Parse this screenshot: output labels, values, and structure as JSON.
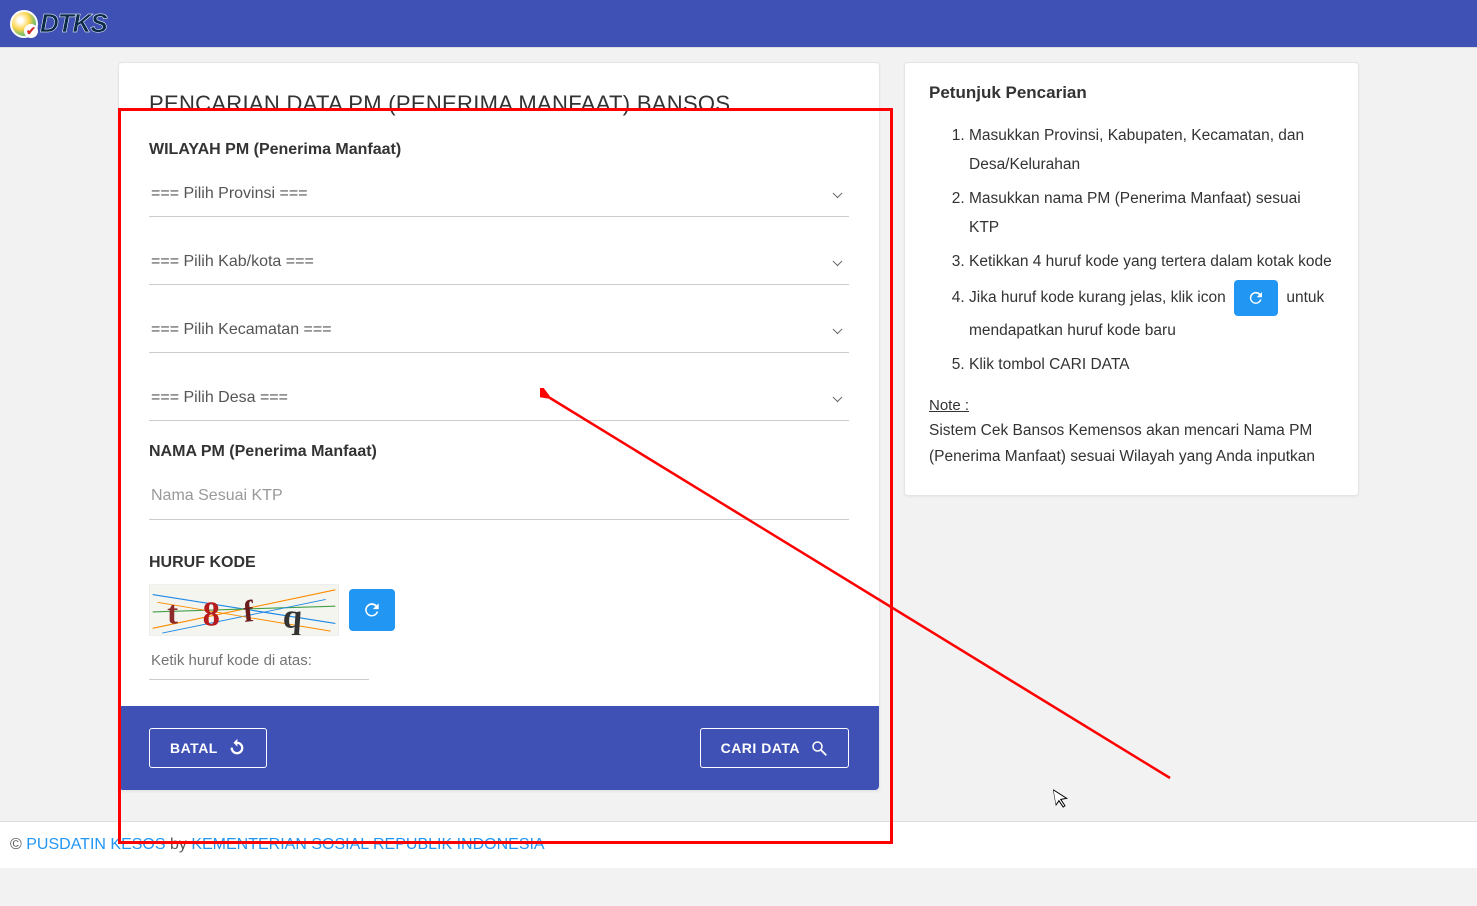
{
  "header": {
    "logo_text": "DTKS"
  },
  "search": {
    "title": "PENCARIAN DATA PM (PENERIMA MANFAAT) BANSOS",
    "wilayah_label": "WILAYAH PM (Penerima Manfaat)",
    "provinsi_placeholder": "=== Pilih Provinsi ===",
    "kabkota_placeholder": "=== Pilih Kab/kota ===",
    "kecamatan_placeholder": "=== Pilih Kecamatan ===",
    "desa_placeholder": "=== Pilih Desa ===",
    "nama_label": "NAMA PM (Penerima Manfaat)",
    "nama_placeholder": "Nama Sesuai KTP",
    "kode_label": "HURUF KODE",
    "captcha_text": "t 8 f q",
    "captcha_input_placeholder": "Ketik huruf kode di atas:",
    "batal_label": "BATAL",
    "cari_label": "CARI DATA"
  },
  "instructions": {
    "title": "Petunjuk Pencarian",
    "step1": "Masukkan Provinsi, Kabupaten, Kecamatan, dan Desa/Kelurahan",
    "step2": "Masukkan nama PM (Penerima Manfaat) sesuai KTP",
    "step3": "Ketikkan 4 huruf kode yang tertera dalam kotak kode",
    "step4a": "Jika huruf kode kurang jelas, klik icon ",
    "step4b": " untuk mendapatkan huruf kode baru",
    "step5": "Klik tombol CARI DATA",
    "note_label": "Note :",
    "note_text": "Sistem Cek Bansos Kemensos akan mencari Nama PM (Penerima Manfaat) sesuai Wilayah yang Anda inputkan"
  },
  "footer": {
    "copyright": "© ",
    "link1": "PUSDATIN KESOS",
    "by": " by ",
    "link2": "KEMENTERIAN SOSIAL REPUBLIK INDONESIA"
  }
}
